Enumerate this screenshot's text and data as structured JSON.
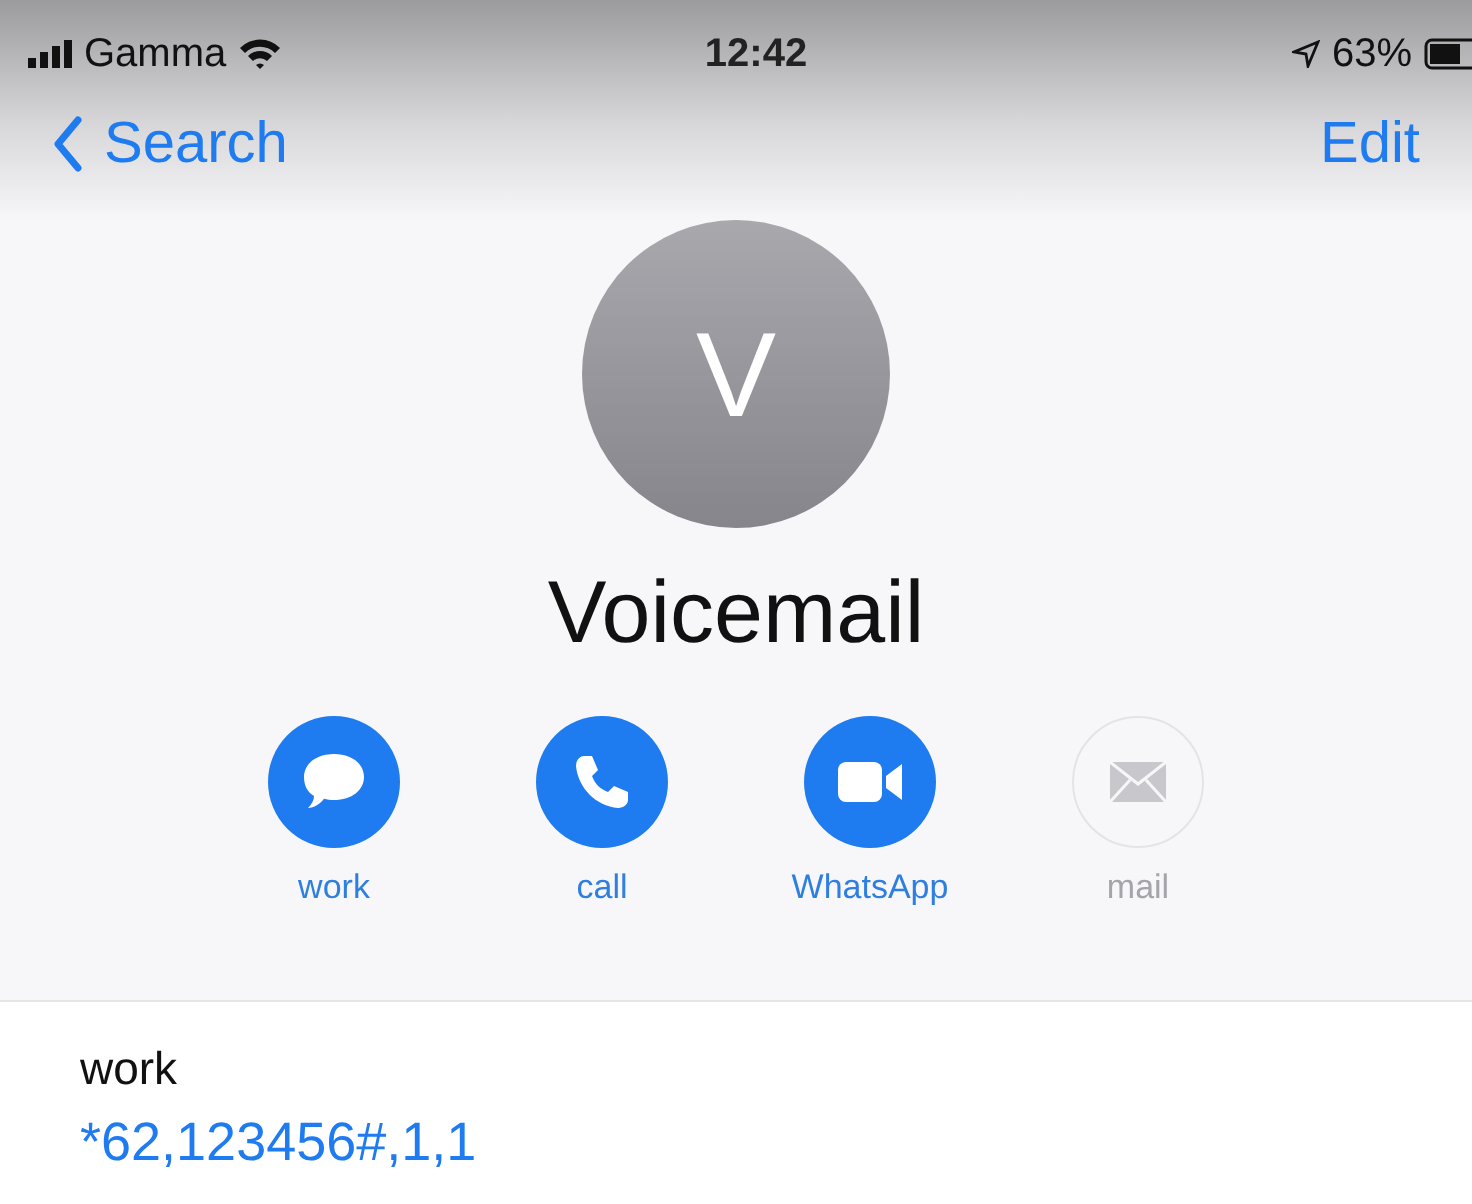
{
  "status_bar": {
    "carrier": "Gamma",
    "time": "12:42",
    "battery": "63%"
  },
  "nav": {
    "back": "Search",
    "action": "Edit"
  },
  "contact": {
    "initial": "V",
    "name": "Voicemail"
  },
  "actions": [
    {
      "kind": "message",
      "label": "work",
      "disabled": false
    },
    {
      "kind": "phone",
      "label": "call",
      "disabled": false
    },
    {
      "kind": "video",
      "label": "WhatsApp",
      "disabled": false
    },
    {
      "kind": "mail",
      "label": "mail",
      "disabled": true
    }
  ],
  "phone": {
    "label": "work",
    "number": "*62,123456#,1,1"
  }
}
